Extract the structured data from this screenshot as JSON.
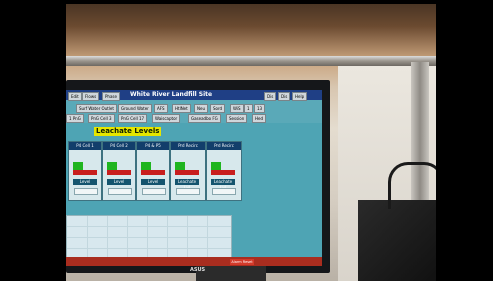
{
  "scene": {
    "background_color": "#000000",
    "photo_colors": {
      "wood": "#6b4a30",
      "wall": "#e4dccf",
      "monitor": "#15171a",
      "screen": "#5aa9b8",
      "title_bar": "#1f3f85"
    },
    "window_title": "White River Landfill Site",
    "menu_buttons": [
      "Edit",
      "Flows",
      "Phase"
    ],
    "window_buttons": [
      "Dis",
      "Dis",
      "Help"
    ],
    "toolbar_row2": [
      "Surf Water Outlet",
      "Ground Water",
      "AFS",
      "HtlNet",
      "Neu",
      "Sord",
      "WiS",
      "1",
      "13"
    ],
    "toolbar_row3": [
      "1 PnG",
      "PnG Cell 3",
      "PnG Cell 17",
      "Waiscaptor",
      "Gaseadbo FG",
      "Session",
      "Hed"
    ],
    "section_title": "Leachate Levels",
    "panels": [
      {
        "title": "P4 Cell 1",
        "status": "",
        "level": "Level"
      },
      {
        "title": "P4 Cell 2",
        "status": "",
        "level": "Level"
      },
      {
        "title": "P4 & P5",
        "status": "",
        "level": "Level"
      },
      {
        "title": "Prd Recirc",
        "status": "",
        "level": "Leachate Lvl"
      },
      {
        "title": "Prd Recirc",
        "status": "",
        "level": "Leachate Lvl"
      }
    ],
    "monitor_brand": "ASUS",
    "footer_button": "Alarm Reset"
  }
}
